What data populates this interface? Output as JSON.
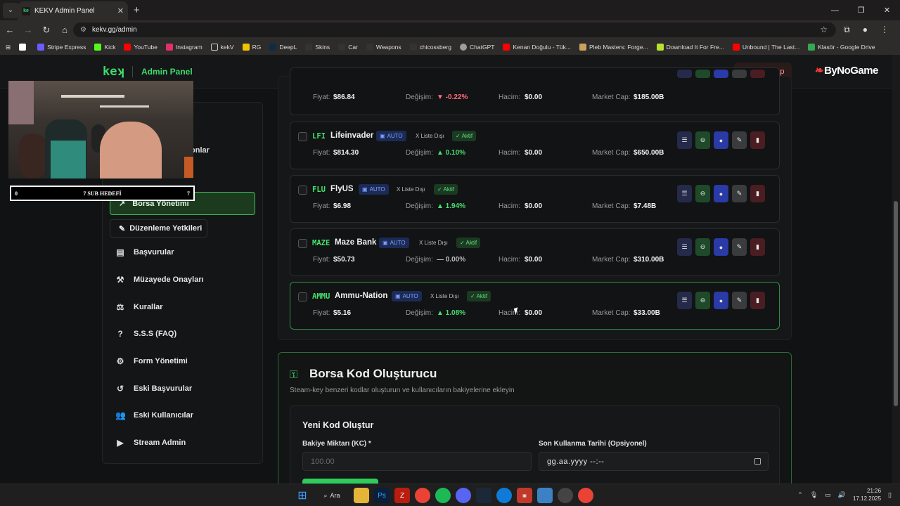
{
  "browser": {
    "tab_title": "KEKV Admin Panel",
    "url": "kekv.gg/admin",
    "bookmarks": [
      "Stripe Express",
      "Kick",
      "YouTube",
      "Instagram",
      "kekV",
      "RG",
      "DeepL",
      "Skins",
      "Car",
      "Weapons",
      "chicossberg",
      "ChatGPT",
      "Kenan Doğulu - Tük...",
      "Pleb Masters: Forge...",
      "Download It For Fre...",
      "Unbound | The Last...",
      "Klasör - Google Drive"
    ]
  },
  "header": {
    "logo": "keʞ",
    "title": "Admin Panel",
    "logout": "Çıkış Yap",
    "sponsor": "ByNoGame"
  },
  "sidebar": {
    "partial": "onlar",
    "active": "Borsa Yönetimi",
    "perm": "Düzenleme Yetkileri",
    "items": [
      "Başvurular",
      "Müzayede Onayları",
      "Kurallar",
      "S.S.S (FAQ)",
      "Form Yönetimi",
      "Eski Başvurular",
      "Eski Kullanıcılar",
      "Stream Admin"
    ]
  },
  "overlay": {
    "left": "0",
    "center": "7 SUB HEDEFİ",
    "right": "7"
  },
  "labels": {
    "price": "Fiyat:",
    "change": "Değişim:",
    "volume": "Hacim:",
    "mcap": "Market Cap:",
    "auto": "AUTO",
    "unlisted": "X Liste Dışı",
    "active": "✓ Aktif"
  },
  "stocks": [
    {
      "sym": "",
      "name": "",
      "price": "$86.84",
      "change": "▼ -0.22%",
      "volume": "$0.00",
      "mcap": "$185.00B"
    },
    {
      "sym": "LFI",
      "name": "Lifeinvader",
      "price": "$814.30",
      "change": "▲ 0.10%",
      "volume": "$0.00",
      "mcap": "$650.00B"
    },
    {
      "sym": "FLU",
      "name": "FlyUS",
      "price": "$6.98",
      "change": "▲ 1.94%",
      "volume": "$0.00",
      "mcap": "$7.48B"
    },
    {
      "sym": "MAZE",
      "name": "Maze Bank",
      "price": "$50.73",
      "change": "— 0.00%",
      "volume": "$0.00",
      "mcap": "$310.00B"
    },
    {
      "sym": "AMMU",
      "name": "Ammu-Nation",
      "price": "$5.16",
      "change": "▲ 1.08%",
      "volume": "$0.00",
      "mcap": "$33.00B"
    }
  ],
  "code": {
    "title": "Borsa Kod Oluşturucu",
    "subtitle": "Steam-key benzeri kodlar oluşturun ve kullanıcıların bakiyelerine ekleyin",
    "form_title": "Yeni Kod Oluştur",
    "amount_label": "Bakiye Miktarı (KC) *",
    "amount_ph": "100.00",
    "expiry_label": "Son Kullanma Tarihi (Opsiyonel)",
    "expiry_val": "gg.aa.yyyy --:--"
  },
  "taskbar": {
    "search": "Ara",
    "time": "21:26",
    "date": "17.12.2025"
  }
}
